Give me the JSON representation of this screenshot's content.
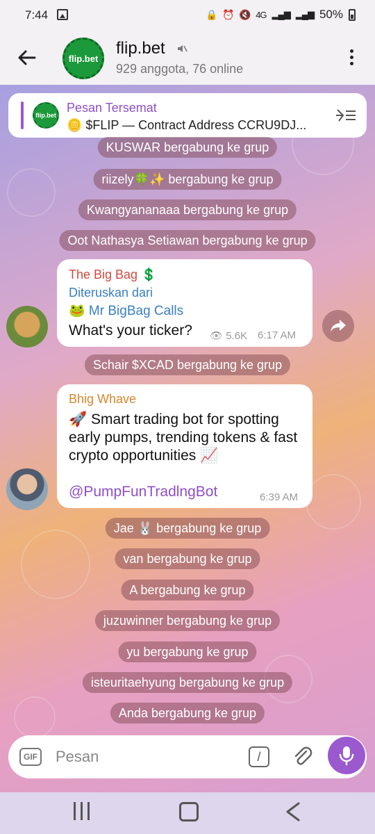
{
  "status_bar": {
    "time": "7:44",
    "network": "4G",
    "battery": "50%"
  },
  "header": {
    "title": "flip.bet",
    "subtitle": "929 anggota, 76 online",
    "avatar_text": "flip.bet"
  },
  "pinned": {
    "label": "Pesan Tersemat",
    "text": "🪙 $FLIP — Contract Address  CCRU9DJ...",
    "thumb_text": "flip.bet"
  },
  "service_messages": [
    "KUSWAR bergabung ke grup",
    "riizely🍀✨ bergabung ke grup",
    "Kwangyananaaa bergabung ke grup",
    "Oot Nathasya Setiawan bergabung ke grup",
    "Schair $XCAD bergabung ke grup",
    "Jae 🐰 bergabung ke grup",
    "van bergabung ke grup",
    "A bergabung ke grup",
    "juzuwinner bergabung ke grup",
    "yu bergabung ke grup",
    "isteuritaehyung bergabung ke grup",
    "Anda bergabung ke grup"
  ],
  "messages": [
    {
      "sender": "The Big Bag 💲",
      "sender_color": "#d24a3f",
      "forwarded_label": "Diteruskan dari",
      "forwarded_from": "🐸 Mr BigBag Calls",
      "text": "What's your ticker?",
      "views": "👁 5.6K",
      "time": "6:17 AM"
    },
    {
      "sender": "Bhig Whave",
      "sender_color": "#d9862a",
      "text": "🚀 Smart trading bot for spotting early pumps, trending tokens & fast crypto opportunities 📈",
      "link": "@PumpFunTradlngBot",
      "time": "6:39 AM"
    }
  ],
  "input": {
    "placeholder": "Pesan",
    "gif_label": "GIF",
    "cmd_label": "/"
  },
  "colors": {
    "accent": "#9b59d0",
    "link": "#8e4fc8",
    "forward": "#3a7fc1"
  }
}
